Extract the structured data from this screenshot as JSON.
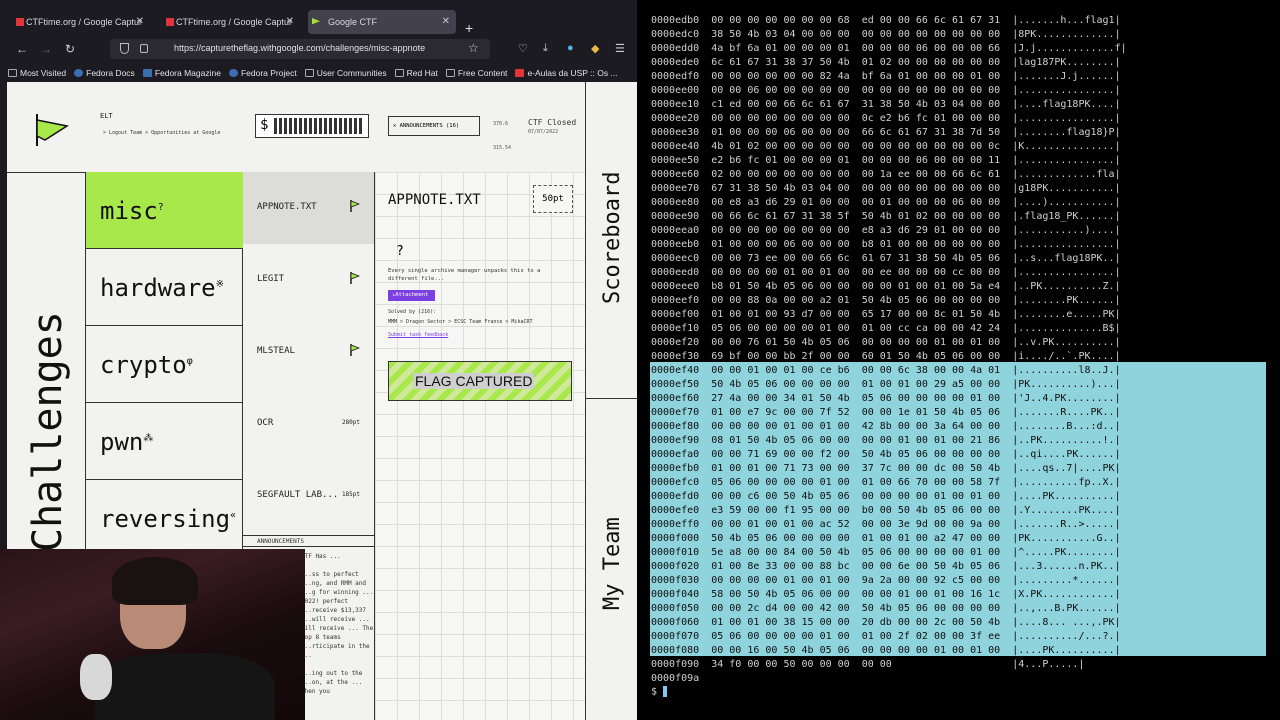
{
  "browser": {
    "tabs": [
      {
        "label": "CTFtime.org / Google Captur",
        "active": false
      },
      {
        "label": "CTFtime.org / Google Captur",
        "active": false
      },
      {
        "label": "Google CTF",
        "active": true
      }
    ],
    "url": "https://capturetheflag.withgoogle.com/challenges/misc-appnote",
    "bookmarks": [
      "Most Visited",
      "Fedora Docs",
      "Fedora Magazine",
      "Fedora Project",
      "User Communities",
      "Red Hat",
      "Free Content",
      "e-Aulas da USP :: Os ..."
    ]
  },
  "ctf": {
    "team_name": "ELT",
    "team_links": "> Logout Team   > Opportunities at Google",
    "announcements_label": "✕ ANNOUNCEMENTS (16)",
    "score_top": "370.6",
    "score_bottom": "315.54",
    "status": "CTF Closed",
    "date": "07/07/2022",
    "section_title": "Challenges",
    "categories": [
      {
        "name": "misc",
        "mark": "?"
      },
      {
        "name": "hardware",
        "mark": "※"
      },
      {
        "name": "crypto",
        "mark": "φ"
      },
      {
        "name": "pwn",
        "mark": "⁂"
      },
      {
        "name": "reversing",
        "mark": "«"
      }
    ],
    "challenges": [
      {
        "name": "APPNOTE.TXT",
        "pts": ""
      },
      {
        "name": "LEGIT",
        "pts": ""
      },
      {
        "name": "MLSTEAL",
        "pts": ""
      },
      {
        "name": "OCR",
        "pts": "280pt"
      },
      {
        "name": "SEGFAULT LAB...",
        "pts": "185pt"
      }
    ],
    "announcements_header": "ANNOUNCEMENTS",
    "announcement_text": "CTF Has ...\n\n...ss to perfect ...ng, and RMM and ...g for winning ... 2022! perfect ...receive $13,337 ...will receive ... will receive ... The top 8 teams ...rticipate in the ...\n\n...ing out to the ...on, at the ... when you",
    "detail": {
      "title": "APPNOTE.TXT",
      "points": "50pt",
      "question": "?",
      "description": "Every single archive manager unpacks this to a different file...",
      "attachment": "↓Attachment",
      "solved": "Solved by (216):",
      "solvers": "MMM  >  Dragon Sector  >  ECSC Team France  >  MikaCRT",
      "submit_feedback": "Submit task feedback",
      "captured": "FLAG CAPTURED"
    },
    "right_top": "Scoreboard",
    "right_bottom": "My Team"
  },
  "terminal": {
    "lines": [
      "0000edb0  00 00 00 00 00 00 00 68  ed 00 00 66 6c 61 67 31  |.......h...flag1|",
      "0000edc0  38 50 4b 03 04 00 00 00  00 00 00 00 00 00 00 00  |8PK.............|",
      "0000edd0  4a bf 6a 01 00 00 00 01  00 00 00 06 00 00 00 66  |J.j.............f|",
      "0000ede0  6c 61 67 31 38 37 50 4b  01 02 00 00 00 00 00 00  |lag187PK........|",
      "0000edf0  00 00 00 00 00 00 82 4a  bf 6a 01 00 00 00 01 00  |.......J.j......|",
      "0000ee00  00 00 06 00 00 00 00 00  00 00 00 00 00 00 00 00  |................|",
      "0000ee10  c1 ed 00 00 66 6c 61 67  31 38 50 4b 03 04 00 00  |....flag18PK....|",
      "0000ee20  00 00 00 00 00 00 00 00  0c e2 b6 fc 01 00 00 00  |................|",
      "0000ee30  01 00 00 00 06 00 00 00  66 6c 61 67 31 38 7d 50  |........flag18}P|",
      "0000ee40  4b 01 02 00 00 00 00 00  00 00 00 00 00 00 00 0c  |K...............|",
      "0000ee50  e2 b6 fc 01 00 00 00 01  00 00 00 06 00 00 00 11  |................|",
      "0000ee60  02 00 00 00 00 00 00 00  00 1a ee 00 00 66 6c 61  |.............fla|",
      "0000ee70  67 31 38 50 4b 03 04 00  00 00 00 00 00 00 00 00  |g18PK...........|",
      "0000ee80  00 e8 a3 d6 29 01 00 00  00 01 00 00 00 06 00 00  |....)...........|",
      "0000ee90  00 66 6c 61 67 31 38 5f  50 4b 01 02 00 00 00 00  |.flag18_PK......|",
      "0000eea0  00 00 00 00 00 00 00 00  e8 a3 d6 29 01 00 00 00  |...........)....|",
      "0000eeb0  01 00 00 00 06 00 00 00  b8 01 00 00 00 00 00 00  |................|",
      "0000eec0  00 00 73 ee 00 00 66 6c  61 67 31 38 50 4b 05 06  |..s...flag18PK..|",
      "0000eed0  00 00 00 00 01 00 01 00  00 ee 00 00 00 cc 00 00  |................|",
      "0000eee0  b8 01 50 4b 05 06 00 00  00 00 01 00 01 00 5a e4  |..PK..........Z.|",
      "0000eef0  00 00 88 0a 00 00 a2 01  50 4b 05 06 00 00 00 00  |........PK......|",
      "0000ef00  01 00 01 00 93 d7 00 00  65 17 00 00 8c 01 50 4b  |........e.....PK|",
      "0000ef10  05 06 00 00 00 00 01 00  01 00 cc ca 00 00 42 24  |..............B$|",
      "0000ef20  00 00 76 01 50 4b 05 06  00 00 00 00 01 00 01 00  |..v.PK..........|",
      "0000ef30  69 bf 00 00 bb 2f 00 00  60 01 50 4b 05 06 00 00  |i..../..`.PK....|",
      "0000ef40  00 00 01 00 01 00 ce b6  00 00 6c 38 00 00 4a 01  |..........l8..J.|",
      "0000ef50  50 4b 05 06 00 00 00 00  01 00 01 00 29 a5 00 00  |PK..........)...|",
      "0000ef60  27 4a 00 00 34 01 50 4b  05 06 00 00 00 00 01 00  |'J..4.PK........|",
      "0000ef70  01 00 e7 9c 00 00 7f 52  00 00 1e 01 50 4b 05 06  |.......R....PK..|",
      "0000ef80  00 00 00 00 01 00 01 00  42 8b 00 00 3a 64 00 00  |........B...:d..|",
      "0000ef90  08 01 50 4b 05 06 00 00  00 00 01 00 01 00 21 86  |..PK..........!.|",
      "0000efa0  00 00 71 69 00 00 f2 00  50 4b 05 06 00 00 00 00  |..qi....PK......|",
      "0000efb0  01 00 01 00 71 73 00 00  37 7c 00 00 dc 00 50 4b  |....qs..7|....PK|",
      "0000efc0  05 06 00 00 00 00 01 00  01 00 66 70 00 00 58 7f  |..........fp..X.|",
      "0000efd0  00 00 c6 00 50 4b 05 06  00 00 00 00 01 00 01 00  |....PK..........|",
      "0000efe0  e3 59 00 00 f1 95 00 00  b0 00 50 4b 05 06 00 00  |.Y........PK....|",
      "0000eff0  00 00 01 00 01 00 ac 52  00 00 3e 9d 00 00 9a 00  |.......R..>.....|",
      "0000f000  50 4b 05 06 00 00 00 00  01 00 01 00 a2 47 00 00  |PK...........G..|",
      "0000f010  5e a8 00 00 84 00 50 4b  05 06 00 00 00 00 01 00  |^.....PK........|",
      "0000f020  01 00 8e 33 00 00 88 bc  00 00 6e 00 50 4b 05 06  |...3......n.PK..|",
      "0000f030  00 00 00 00 01 00 01 00  9a 2a 00 00 92 c5 00 00  |.........*......|",
      "0000f040  58 00 50 4b 05 06 00 00  00 00 01 00 01 00 16 1c  |X.PK............|",
      "0000f050  00 00 2c d4 00 00 42 00  50 4b 05 06 00 00 00 00  |..,...B.PK......|",
      "0000f060  01 00 01 00 38 15 00 00  20 db 00 00 2c 00 50 4b  |....8... ...,.PK|",
      "0000f070  05 06 00 00 00 00 01 00  01 00 2f 02 00 00 3f ee  |........../...?.|",
      "0000f080  00 00 16 00 50 4b 05 06  00 00 00 00 01 00 01 00  |....PK..........|",
      "0000f090  34 f0 00 00 50 00 00 00  00 00                    |4...P.....|",
      "0000f09a"
    ],
    "prompt": "$"
  }
}
